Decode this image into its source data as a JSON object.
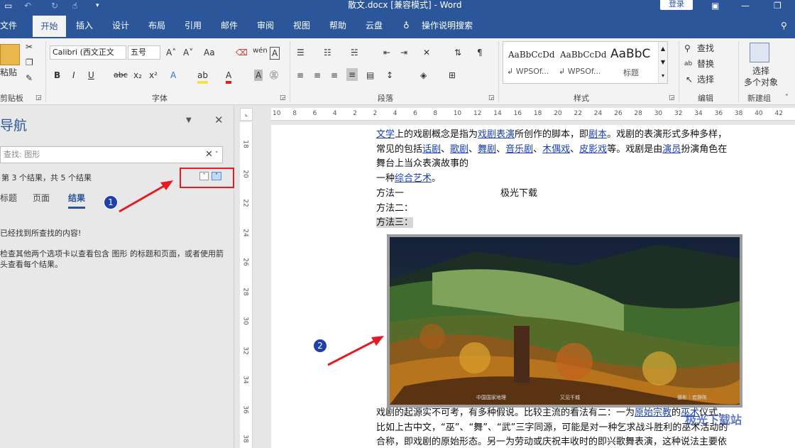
{
  "titlebar": {
    "doc_title": "散文.docx [兼容模式] - Word",
    "login": "登录"
  },
  "tabs": [
    "文件",
    "开始",
    "插入",
    "设计",
    "布局",
    "引用",
    "邮件",
    "审阅",
    "视图",
    "帮助",
    "云盘",
    "操作说明搜索"
  ],
  "ribbon": {
    "clipboard": {
      "paste": "粘贴",
      "label": "剪贴板"
    },
    "font": {
      "name": "Calibri (西文正文",
      "size": "五号",
      "label": "字体",
      "change_case": "Aa"
    },
    "paragraph": {
      "label": "段落"
    },
    "styles": {
      "label": "样式",
      "items": [
        {
          "preview": "AaBbCcDd",
          "name": "↲ WPSOf..."
        },
        {
          "preview": "AaBbCcDd",
          "name": "↲ WPSOf..."
        },
        {
          "preview": "AaBbC",
          "name": "标题"
        }
      ]
    },
    "editing": {
      "find": "查找",
      "replace": "替换",
      "select": "选择",
      "label": "编辑"
    },
    "newgroup": {
      "select_multi_1": "选择",
      "select_multi_2": "多个对象",
      "label": "新建组"
    }
  },
  "nav": {
    "title": "导航",
    "search_value": "查找: 图形",
    "result_count": "第 3 个结果，共 5 个结果",
    "tabs": [
      "标题",
      "页面",
      "结果"
    ],
    "msg1": "已经找到所查找的内容!",
    "msg2": "检查其他两个选项卡以查看包含 图形 的标题和页面，或者使用箭头查看每个结果。"
  },
  "hruler_numbers": [
    "10",
    "8",
    "6",
    "4",
    "2",
    "2",
    "4",
    "6",
    "8",
    "10",
    "12",
    "14",
    "16",
    "18",
    "20",
    "22",
    "24",
    "26",
    "28",
    "30",
    "32",
    "34",
    "36",
    "38",
    "40",
    "42"
  ],
  "vruler_numbers": [
    "18",
    "20",
    "22",
    "24",
    "26",
    "28",
    "30",
    "32",
    "34",
    "36",
    "38"
  ],
  "doc": {
    "line1_a": "文学",
    "line1_b": "上的戏剧概念是指为",
    "line1_c": "戏剧表演",
    "line1_d": "所创作的脚本，即",
    "line1_e": "剧本",
    "line1_f": "。戏剧的表演形式多种多样，",
    "line2_a": "常见的包括",
    "line2_b": "话剧",
    "line2_c": "、",
    "line2_d": "歌剧",
    "line2_e": "、",
    "line2_f": "舞剧",
    "line2_g": "、",
    "line2_h": "音乐剧",
    "line2_i": "、",
    "line2_j": "木偶戏",
    "line2_k": "、",
    "line2_l": "皮影戏",
    "line2_m": "等。戏剧是由",
    "line2_n": "演员",
    "line2_o": "扮演角色在",
    "line3": "舞台上当众表演故事的",
    "line4_a": "一种",
    "line4_b": "综合艺术",
    "line4_c": "。",
    "line5_a": "方法一",
    "line5_b": "极光下载",
    "line6": "方法二：",
    "line7": "方法三：",
    "line8_a": "戏剧的起源实不可考，有多种假说。比较主流的看法有二：一为",
    "line8_b": "原始宗教",
    "line8_c": "的",
    "line8_d": "巫术",
    "line8_e": "仪式，",
    "line9": "比如上古中文，“巫”、“舞”、“武”三字同源，可能是对一种乞求战斗胜利的巫术活动的",
    "line10": "合称，即戏剧的原始形态。另一为劳动或庆祝丰收时的即兴歌舞表演，这种说法主要依"
  },
  "photo_caption": {
    "left": "中国国家地理",
    "mid": "又见千城",
    "right": "摄影｜若静陈"
  },
  "badges": {
    "one": "1",
    "two": "2"
  },
  "watermark": "极光下载站"
}
